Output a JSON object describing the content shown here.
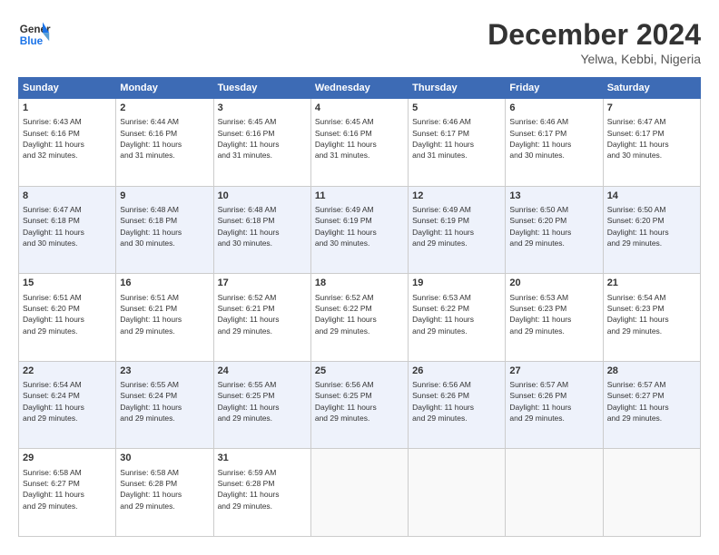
{
  "header": {
    "logo_line1": "General",
    "logo_line2": "Blue",
    "month": "December 2024",
    "location": "Yelwa, Kebbi, Nigeria"
  },
  "days_of_week": [
    "Sunday",
    "Monday",
    "Tuesday",
    "Wednesday",
    "Thursday",
    "Friday",
    "Saturday"
  ],
  "weeks": [
    [
      {
        "day": "1",
        "info": "Sunrise: 6:43 AM\nSunset: 6:16 PM\nDaylight: 11 hours\nand 32 minutes."
      },
      {
        "day": "2",
        "info": "Sunrise: 6:44 AM\nSunset: 6:16 PM\nDaylight: 11 hours\nand 31 minutes."
      },
      {
        "day": "3",
        "info": "Sunrise: 6:45 AM\nSunset: 6:16 PM\nDaylight: 11 hours\nand 31 minutes."
      },
      {
        "day": "4",
        "info": "Sunrise: 6:45 AM\nSunset: 6:16 PM\nDaylight: 11 hours\nand 31 minutes."
      },
      {
        "day": "5",
        "info": "Sunrise: 6:46 AM\nSunset: 6:17 PM\nDaylight: 11 hours\nand 31 minutes."
      },
      {
        "day": "6",
        "info": "Sunrise: 6:46 AM\nSunset: 6:17 PM\nDaylight: 11 hours\nand 30 minutes."
      },
      {
        "day": "7",
        "info": "Sunrise: 6:47 AM\nSunset: 6:17 PM\nDaylight: 11 hours\nand 30 minutes."
      }
    ],
    [
      {
        "day": "8",
        "info": "Sunrise: 6:47 AM\nSunset: 6:18 PM\nDaylight: 11 hours\nand 30 minutes."
      },
      {
        "day": "9",
        "info": "Sunrise: 6:48 AM\nSunset: 6:18 PM\nDaylight: 11 hours\nand 30 minutes."
      },
      {
        "day": "10",
        "info": "Sunrise: 6:48 AM\nSunset: 6:18 PM\nDaylight: 11 hours\nand 30 minutes."
      },
      {
        "day": "11",
        "info": "Sunrise: 6:49 AM\nSunset: 6:19 PM\nDaylight: 11 hours\nand 30 minutes."
      },
      {
        "day": "12",
        "info": "Sunrise: 6:49 AM\nSunset: 6:19 PM\nDaylight: 11 hours\nand 29 minutes."
      },
      {
        "day": "13",
        "info": "Sunrise: 6:50 AM\nSunset: 6:20 PM\nDaylight: 11 hours\nand 29 minutes."
      },
      {
        "day": "14",
        "info": "Sunrise: 6:50 AM\nSunset: 6:20 PM\nDaylight: 11 hours\nand 29 minutes."
      }
    ],
    [
      {
        "day": "15",
        "info": "Sunrise: 6:51 AM\nSunset: 6:20 PM\nDaylight: 11 hours\nand 29 minutes."
      },
      {
        "day": "16",
        "info": "Sunrise: 6:51 AM\nSunset: 6:21 PM\nDaylight: 11 hours\nand 29 minutes."
      },
      {
        "day": "17",
        "info": "Sunrise: 6:52 AM\nSunset: 6:21 PM\nDaylight: 11 hours\nand 29 minutes."
      },
      {
        "day": "18",
        "info": "Sunrise: 6:52 AM\nSunset: 6:22 PM\nDaylight: 11 hours\nand 29 minutes."
      },
      {
        "day": "19",
        "info": "Sunrise: 6:53 AM\nSunset: 6:22 PM\nDaylight: 11 hours\nand 29 minutes."
      },
      {
        "day": "20",
        "info": "Sunrise: 6:53 AM\nSunset: 6:23 PM\nDaylight: 11 hours\nand 29 minutes."
      },
      {
        "day": "21",
        "info": "Sunrise: 6:54 AM\nSunset: 6:23 PM\nDaylight: 11 hours\nand 29 minutes."
      }
    ],
    [
      {
        "day": "22",
        "info": "Sunrise: 6:54 AM\nSunset: 6:24 PM\nDaylight: 11 hours\nand 29 minutes."
      },
      {
        "day": "23",
        "info": "Sunrise: 6:55 AM\nSunset: 6:24 PM\nDaylight: 11 hours\nand 29 minutes."
      },
      {
        "day": "24",
        "info": "Sunrise: 6:55 AM\nSunset: 6:25 PM\nDaylight: 11 hours\nand 29 minutes."
      },
      {
        "day": "25",
        "info": "Sunrise: 6:56 AM\nSunset: 6:25 PM\nDaylight: 11 hours\nand 29 minutes."
      },
      {
        "day": "26",
        "info": "Sunrise: 6:56 AM\nSunset: 6:26 PM\nDaylight: 11 hours\nand 29 minutes."
      },
      {
        "day": "27",
        "info": "Sunrise: 6:57 AM\nSunset: 6:26 PM\nDaylight: 11 hours\nand 29 minutes."
      },
      {
        "day": "28",
        "info": "Sunrise: 6:57 AM\nSunset: 6:27 PM\nDaylight: 11 hours\nand 29 minutes."
      }
    ],
    [
      {
        "day": "29",
        "info": "Sunrise: 6:58 AM\nSunset: 6:27 PM\nDaylight: 11 hours\nand 29 minutes."
      },
      {
        "day": "30",
        "info": "Sunrise: 6:58 AM\nSunset: 6:28 PM\nDaylight: 11 hours\nand 29 minutes."
      },
      {
        "day": "31",
        "info": "Sunrise: 6:59 AM\nSunset: 6:28 PM\nDaylight: 11 hours\nand 29 minutes."
      },
      {
        "day": "",
        "info": ""
      },
      {
        "day": "",
        "info": ""
      },
      {
        "day": "",
        "info": ""
      },
      {
        "day": "",
        "info": ""
      }
    ]
  ]
}
